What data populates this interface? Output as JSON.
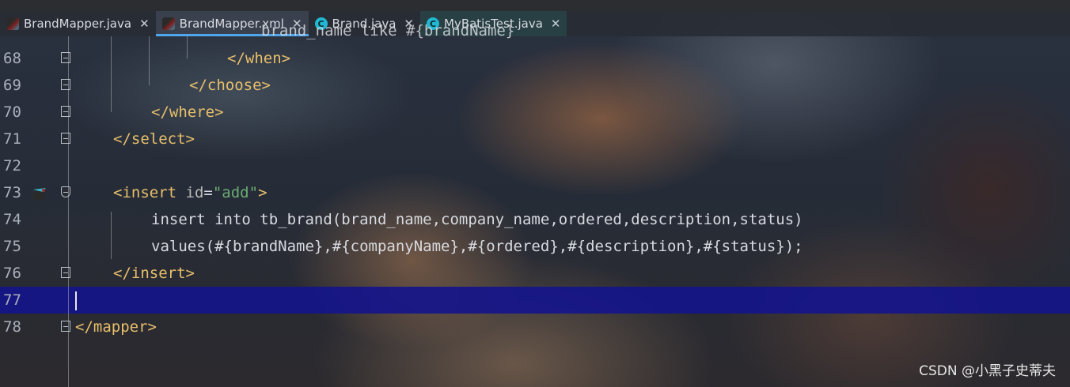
{
  "tabs": [
    {
      "label": "BrandMapper.java",
      "icon": "mybatis-bird-icon",
      "active": false
    },
    {
      "label": "BrandMapper.xml",
      "icon": "mybatis-bird-icon",
      "active": true
    },
    {
      "label": "Brand.java",
      "icon": "class-icon",
      "active": false
    },
    {
      "label": "MyBatisTest.java",
      "icon": "test-class-icon",
      "active": false
    }
  ],
  "lines": [
    {
      "num": "68",
      "indent": 4,
      "parts": [
        {
          "t": "</when>",
          "c": "tag"
        }
      ]
    },
    {
      "num": "69",
      "indent": 3,
      "parts": [
        {
          "t": "</choose>",
          "c": "tag"
        }
      ]
    },
    {
      "num": "70",
      "indent": 2,
      "parts": [
        {
          "t": "</where>",
          "c": "tag"
        }
      ]
    },
    {
      "num": "71",
      "indent": 1,
      "parts": [
        {
          "t": "</select>",
          "c": "tag"
        }
      ]
    },
    {
      "num": "72",
      "indent": 0,
      "parts": []
    },
    {
      "num": "73",
      "indent": 1,
      "parts": [
        {
          "t": "<insert ",
          "c": "tag"
        },
        {
          "t": "id",
          "c": "attr"
        },
        {
          "t": "=",
          "c": "plain"
        },
        {
          "t": "\"add\"",
          "c": "str"
        },
        {
          "t": ">",
          "c": "tag"
        }
      ]
    },
    {
      "num": "74",
      "indent": 2,
      "parts": [
        {
          "t": "insert into tb_brand(brand_name,company_name,ordered,description,status)",
          "c": "plain"
        }
      ]
    },
    {
      "num": "75",
      "indent": 2,
      "parts": [
        {
          "t": "values(#{brandName},#{companyName},#{ordered},#{description},#{status});",
          "c": "plain"
        }
      ]
    },
    {
      "num": "76",
      "indent": 1,
      "parts": [
        {
          "t": "</insert>",
          "c": "tag"
        }
      ]
    },
    {
      "num": "77",
      "indent": 0,
      "parts": []
    },
    {
      "num": "78",
      "indent": 0,
      "parts": [
        {
          "t": "</mapper>",
          "c": "tag"
        }
      ]
    }
  ],
  "partial_line": "brand_name like #{brandName}",
  "current_line": "77",
  "watermark": "CSDN @小黑子史蒂夫",
  "colors": {
    "tag": "#e8bf6a",
    "string": "#6aab73",
    "current_line": "#14148c",
    "tab_underline": "#4fa6ea"
  }
}
